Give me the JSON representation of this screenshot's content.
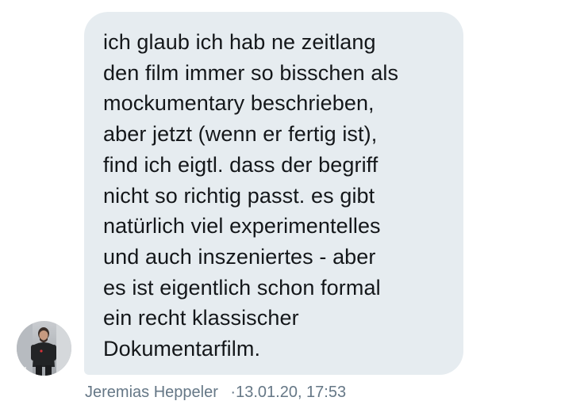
{
  "message": {
    "lines": [
      "ich glaub ich hab ne zeitlang",
      "den film immer so bisschen als",
      "mockumentary beschrieben,",
      "aber jetzt (wenn er fertig ist),",
      "find ich eigtl. dass der begriff",
      "nicht so richtig passt. es gibt",
      "natürlich viel experimentelles",
      "und auch inszeniertes - aber",
      "es ist eigentlich schon formal",
      "ein recht klassischer",
      "Dokumentarfilm."
    ]
  },
  "sender": {
    "name": "Jeremias Heppeler",
    "separator": "·",
    "timestamp": "13.01.20, 17:53"
  },
  "colors": {
    "bubble": "#e6ecf0",
    "text": "#14171a",
    "meta": "#657786"
  }
}
